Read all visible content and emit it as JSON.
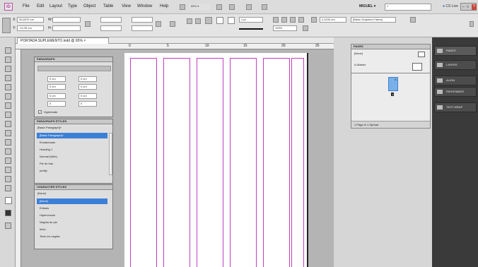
{
  "app_logo": "ID",
  "menubar": {
    "items": [
      "File",
      "Edit",
      "Layout",
      "Type",
      "Object",
      "Table",
      "View",
      "Window",
      "Help"
    ],
    "zoom": "65%",
    "workspace": "MIGUEL",
    "search_placeholder": "",
    "cslive": "CS Live"
  },
  "control": {
    "x_label": "X:",
    "x_value": "30,8375 cm",
    "y_label": "Y:",
    "y_value": "-14,25 cm",
    "w_label": "W:",
    "h_label": "H:",
    "stroke_value": "1 pt",
    "opacity_value": "100%",
    "width_value": "0,4233 cm",
    "frame_style": "[Basic Graphics Frame]"
  },
  "document": {
    "tab_title": "PORTADA SUPLEMENTO.indd @ 65%",
    "ruler_marks": [
      "0",
      "5",
      "10",
      "15",
      "20",
      "25",
      "30"
    ]
  },
  "paragraph_panel": {
    "title": "PARAGRAPH",
    "fields": [
      "0 cm",
      "0 cm",
      "0 cm",
      "0 cm",
      "0 cm",
      "0 cm",
      "0",
      "0"
    ],
    "hyphenate_label": "Hyphenate"
  },
  "paragraph_styles": {
    "title": "PARAGRAPH STYLES",
    "current": "[Basic Paragraph]+",
    "items": [
      "[Basic Paragraph]+",
      "Encabezado",
      "Heading 1",
      "Normal (Web)",
      "Pie de foto",
      "prefijo"
    ]
  },
  "character_styles": {
    "title": "CHARACTER STYLES",
    "current": "[None]",
    "items": [
      "[None]",
      "Enfasis",
      "Hipervínculo",
      "Negrita de pie",
      "texto",
      "Texto en negrita"
    ]
  },
  "pages_panel": {
    "title": "PAGES",
    "none_label": "[None]",
    "master_label": "A-Master",
    "page_number": "1",
    "page_letter": "A",
    "footer": "1 Page in 1 Spread"
  },
  "dock": {
    "items": [
      "PAGES",
      "LAYERS",
      "ALIGN",
      "PATHFINDER",
      "TEXT WRAP"
    ]
  },
  "colors": {
    "selection": "#3c7fd6",
    "column_guides": "#c03cc0",
    "dock_bg": "#3a3a3a"
  }
}
